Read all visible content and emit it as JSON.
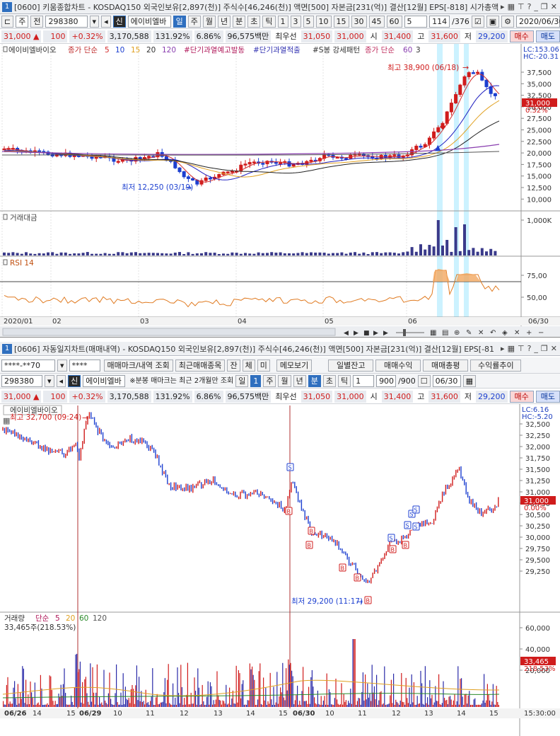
{
  "w1": {
    "title_num": "1",
    "title": "[0600] 키움종합차트 - KOSDAQ150 외국인보유[2,897(천)] 주식수[46,246(천)] 액면[500] 자본금[231(억)] 결산[12월] EPS[-818] 시가총액",
    "toolbar": {
      "type": "주",
      "all": "전",
      "code": "298380",
      "sin": "신",
      "name": "에이비엘바",
      "periods": [
        "일",
        "주",
        "월",
        "년",
        "분",
        "초",
        "틱"
      ],
      "nums": [
        "1",
        "3",
        "5",
        "10",
        "15",
        "30",
        "45",
        "60"
      ],
      "num_sel": "5",
      "count": "114",
      "total": "/376",
      "date": "2020/06/30"
    },
    "price": {
      "last": "31,000 ▲",
      "chg": "100",
      "pct": "+0.32%",
      "vol": "3,170,588",
      "vol_pct": "131.92%",
      "turn": "6.86%",
      "amt": "96,575백만",
      "pref_label": "최우선",
      "pref1": "31,050",
      "pref2": "31,000",
      "open_label": "시",
      "open": "31,400",
      "high_label": "고",
      "high": "31,600",
      "low_label": "저",
      "low": "29,200",
      "buy": "매수",
      "sell": "매도"
    },
    "legend": {
      "name": "에이비엘바이오",
      "ma_label": "종가 단순",
      "ma": [
        "5",
        "10",
        "15",
        "20",
        "120"
      ],
      "tag1": "#단기과열예고발동",
      "tag2": "#단기과열적출",
      "tag3": "#S봉 강세패턴",
      "ma2_label": "종가 단순",
      "ma2": [
        "60",
        "3"
      ]
    },
    "lc": "LC:153.06",
    "hc": "HC:-20.31",
    "yticks": [
      "37,500",
      "35,000",
      "32,500",
      "30,000",
      "27,500",
      "25,000",
      "22,500",
      "20,000",
      "17,500",
      "15,000",
      "12,500",
      "10,000"
    ],
    "price_tag": "31,000",
    "price_tag_pct": "0.32%",
    "hi_note": "최고 38,900 (06/18)",
    "lo_note": "최저 12,250 (03/19)",
    "vol_title": "거래대금",
    "vol_tick": "1,000K",
    "rsi_title": "RSI 14",
    "rsi_ticks": [
      "75,00",
      "50,00"
    ],
    "xlabels": [
      "2020/01",
      "02",
      "03",
      "04",
      "05",
      "06"
    ],
    "xlast": "06/30"
  },
  "w2": {
    "title_num": "1",
    "title": "[0606] 자동일지차트(매매내역) - KOSDAQ150 외국인보유[2,897(천)] 주식수[46,246(천)] 액면[500] 자본금[231(억)] 결산[12월] EPS[-81",
    "acct": "****-**70",
    "pw": "****",
    "btns": [
      "매매마크/내역 조회",
      "최근매매종목",
      "잔",
      "체",
      "미",
      "메모보기"
    ],
    "btns2": [
      "일별잔고",
      "매매수익",
      "매매총평",
      "수익률추이"
    ],
    "toolbar": {
      "code": "298380",
      "sin": "신",
      "name": "에이비엘바",
      "note": "※분봉 매마크는 최근 2개월만 조회",
      "per": "일",
      "per_num": "1",
      "periods": [
        "주",
        "월",
        "년",
        "분",
        "초",
        "틱"
      ],
      "num": "1",
      "count": "900",
      "total": "/900",
      "date": "06/30"
    },
    "price": {
      "last": "31,000 ▲",
      "chg": "100",
      "pct": "+0.32%",
      "vol": "3,170,588",
      "vol_pct": "131.92%",
      "turn": "6.86%",
      "amt": "96,575백만",
      "pref_label": "최우선",
      "pref1": "31,050",
      "pref2": "31,000",
      "open_label": "시",
      "open": "31,400",
      "high_label": "고",
      "high": "31,600",
      "low_label": "저",
      "low": "29,200",
      "buy": "매수",
      "sell": "매도"
    },
    "legend": "에이비엘바이오",
    "lc": "LC:6.16",
    "hc": "HC:-5.20",
    "yticks": [
      "32,500",
      "32,250",
      "32,000",
      "31,750",
      "31,500",
      "31,250",
      "31,000",
      "30,750",
      "30,500",
      "30,250",
      "30,000",
      "29,750",
      "29,500",
      "29,250"
    ],
    "price_tag": "31,000",
    "price_tag_pct": "0.00%",
    "hi_note": "최고 32,700 (09:24)",
    "lo_note": "최저 29,200 (11:17)",
    "vol_title": "거래량",
    "vol_ma_label": "단순",
    "vol_ma": [
      "5",
      "20",
      "60",
      "120"
    ],
    "vol_note": "33,465주(218.53%)",
    "vol_ticks": [
      "60,000",
      "40,000",
      "20,000"
    ],
    "vol_tag": "33,465",
    "vol_tag_pct": "218.53%",
    "xlabels": [
      "06/26",
      "14",
      "15",
      "06/29",
      "10",
      "11",
      "12",
      "13",
      "14",
      "15",
      "06/30",
      "10",
      "11",
      "12",
      "13",
      "14",
      "15"
    ],
    "xlast": "15:30:00"
  },
  "colors": {
    "up": "#d01c1c",
    "down": "#1c3fd0",
    "accent": "#2f6fbf",
    "highlight": "#bfefff",
    "ma5": "#d32b2b",
    "ma20": "#e0a020",
    "ma60": "#8a3fb0",
    "ma120": "#333333",
    "rsi": "#e07a20"
  }
}
